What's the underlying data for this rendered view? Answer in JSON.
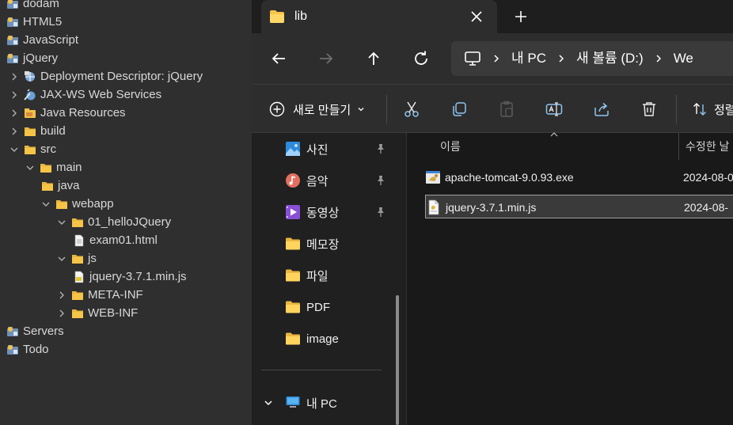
{
  "eclipse_tree": {
    "items": [
      {
        "label": "dodam",
        "icon": "project-icon",
        "arrow": "none"
      },
      {
        "label": "HTML5",
        "icon": "project-icon",
        "arrow": "none"
      },
      {
        "label": "JavaScript",
        "icon": "project-icon",
        "arrow": "none"
      },
      {
        "label": "jQuery",
        "icon": "project-icon",
        "arrow": "none"
      },
      {
        "label": "Deployment Descriptor: jQuery",
        "icon": "deployment-descriptor-icon",
        "arrow": "collapsed"
      },
      {
        "label": "JAX-WS Web Services",
        "icon": "web-services-icon",
        "arrow": "collapsed"
      },
      {
        "label": "Java Resources",
        "icon": "java-resources-icon",
        "arrow": "collapsed"
      },
      {
        "label": "build",
        "icon": "folder-icon",
        "arrow": "collapsed"
      },
      {
        "label": "src",
        "icon": "folder-icon",
        "arrow": "expanded"
      },
      {
        "label": "main",
        "icon": "folder-icon",
        "arrow": "expanded"
      },
      {
        "label": "java",
        "icon": "folder-icon",
        "arrow": "none"
      },
      {
        "label": "webapp",
        "icon": "folder-icon",
        "arrow": "expanded"
      },
      {
        "label": "01_helloJQuery",
        "icon": "folder-icon",
        "arrow": "expanded"
      },
      {
        "label": "exam01.html",
        "icon": "file-icon",
        "arrow": "none"
      },
      {
        "label": "js",
        "icon": "folder-icon",
        "arrow": "expanded"
      },
      {
        "label": "jquery-3.7.1.min.js",
        "icon": "js-file-icon",
        "arrow": "none"
      },
      {
        "label": "META-INF",
        "icon": "folder-icon",
        "arrow": "collapsed"
      },
      {
        "label": "WEB-INF",
        "icon": "folder-icon",
        "arrow": "collapsed"
      },
      {
        "label": "Servers",
        "icon": "project-icon",
        "arrow": "none"
      },
      {
        "label": "Todo",
        "icon": "project-icon",
        "arrow": "none"
      }
    ]
  },
  "file_explorer": {
    "tab_title": "lib",
    "address": {
      "crumbs": [
        "내 PC",
        "새 볼륨 (D:)",
        "We"
      ]
    },
    "command_bar": {
      "new_label": "새로 만들기",
      "sort_label": "정렬"
    },
    "nav_pane": {
      "items": [
        {
          "label": "사진",
          "icon": "photos-icon",
          "pinned": true
        },
        {
          "label": "음악",
          "icon": "music-icon",
          "pinned": true
        },
        {
          "label": "동영상",
          "icon": "video-icon",
          "pinned": true
        },
        {
          "label": "메모장",
          "icon": "folder-icon",
          "pinned": false
        },
        {
          "label": "파일",
          "icon": "folder-icon",
          "pinned": false
        },
        {
          "label": "PDF",
          "icon": "folder-icon",
          "pinned": false
        },
        {
          "label": "image",
          "icon": "folder-icon",
          "pinned": false
        }
      ],
      "this_pc_label": "내 PC"
    },
    "file_list": {
      "columns": {
        "name": "이름",
        "date": "수정한 날"
      },
      "files": [
        {
          "name": "apache-tomcat-9.0.93.exe",
          "date": "2024-08-0",
          "icon": "exe-icon",
          "selected": false
        },
        {
          "name": "jquery-3.7.1.min.js",
          "date": "2024-08-",
          "icon": "js-file-icon",
          "selected": true
        }
      ]
    }
  },
  "colors": {
    "eclipse_bg": "#2f2f2f",
    "explorer_bg": "#191919",
    "toolbar_bg": "#2d2d2d",
    "folder_yellow": "#f6c548",
    "accent_blue": "#5aa7e8"
  }
}
